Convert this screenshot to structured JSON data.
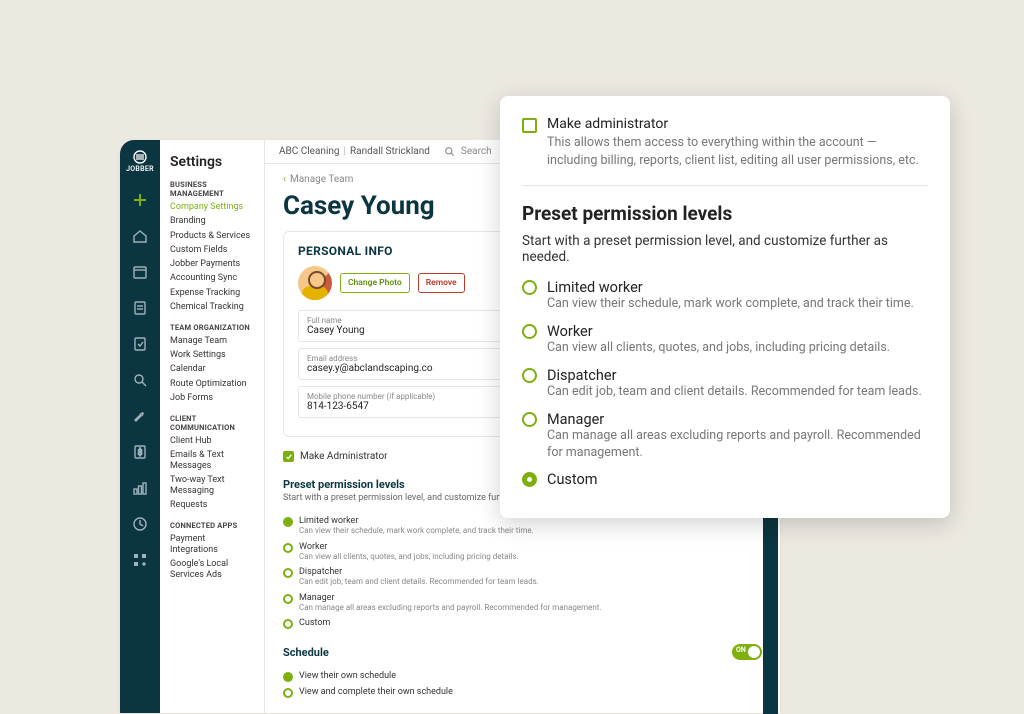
{
  "header": {
    "org": "ABC Cleaning",
    "user": "Randall Strickland",
    "search_placeholder": "Search"
  },
  "sidebar": {
    "title": "Settings",
    "groups": [
      {
        "label": "BUSINESS MANAGEMENT",
        "items": [
          {
            "label": "Company Settings",
            "active": true
          },
          {
            "label": "Branding"
          },
          {
            "label": "Products & Services"
          },
          {
            "label": "Custom Fields"
          },
          {
            "label": "Jobber Payments"
          },
          {
            "label": "Accounting Sync"
          },
          {
            "label": "Expense Tracking"
          },
          {
            "label": "Chemical Tracking"
          }
        ]
      },
      {
        "label": "TEAM ORGANIZATION",
        "items": [
          {
            "label": "Manage Team"
          },
          {
            "label": "Work Settings"
          },
          {
            "label": "Calendar"
          },
          {
            "label": "Route Optimization"
          },
          {
            "label": "Job Forms"
          }
        ]
      },
      {
        "label": "CLIENT COMMUNICATION",
        "items": [
          {
            "label": "Client Hub"
          },
          {
            "label": "Emails & Text Messages"
          },
          {
            "label": "Two-way Text Messaging"
          },
          {
            "label": "Requests"
          }
        ]
      },
      {
        "label": "CONNECTED APPS",
        "items": [
          {
            "label": "Payment Integrations"
          },
          {
            "label": "Google's Local Services Ads"
          }
        ]
      }
    ]
  },
  "breadcrumb": {
    "back": "Manage Team"
  },
  "page": {
    "title": "Casey Young",
    "personal_info": {
      "heading": "PERSONAL INFO",
      "change_photo": "Change Photo",
      "remove": "Remove",
      "full_name_label": "Full name",
      "full_name": "Casey Young",
      "email_label": "Email address",
      "email": "casey.y@abclandscaping.co",
      "phone_label": "Mobile phone number (if applicable)",
      "phone": "814-123-6547"
    },
    "make_admin": "Make Administrator",
    "preset": {
      "heading": "Preset permission levels",
      "subtitle": "Start with a preset permission level, and customize further as needed.",
      "options": [
        {
          "title": "Limited worker",
          "desc": "Can view their schedule, mark work complete, and track their time.",
          "selected": true
        },
        {
          "title": "Worker",
          "desc": "Can view all clients, quotes, and jobs, including pricing details."
        },
        {
          "title": "Dispatcher",
          "desc": "Can edit job, team and client details. Recommended for team leads."
        },
        {
          "title": "Manager",
          "desc": "Can manage all areas excluding reports and payroll. Recommended for management."
        },
        {
          "title": "Custom"
        }
      ]
    },
    "schedule": {
      "heading": "Schedule",
      "toggle_label": "ON",
      "options": [
        {
          "label": "View their own schedule",
          "selected": true
        },
        {
          "label": "View and complete their own schedule"
        }
      ]
    }
  },
  "popover": {
    "admin_title": "Make administrator",
    "admin_desc": "This allows them access to everything within the account — including billing, reports, client list, editing all user permissions, etc.",
    "heading": "Preset permission levels",
    "subtitle": "Start with a preset permission level, and customize further as needed.",
    "options": [
      {
        "title": "Limited worker",
        "desc": "Can view their schedule, mark work complete, and track their time."
      },
      {
        "title": "Worker",
        "desc": "Can view all clients, quotes, and jobs, including pricing details."
      },
      {
        "title": "Dispatcher",
        "desc": "Can edit job, team and client details. Recommended for team leads."
      },
      {
        "title": "Manager",
        "desc": "Can manage all areas excluding reports and payroll. Recommended for management."
      },
      {
        "title": "Custom",
        "selected": true
      }
    ]
  }
}
